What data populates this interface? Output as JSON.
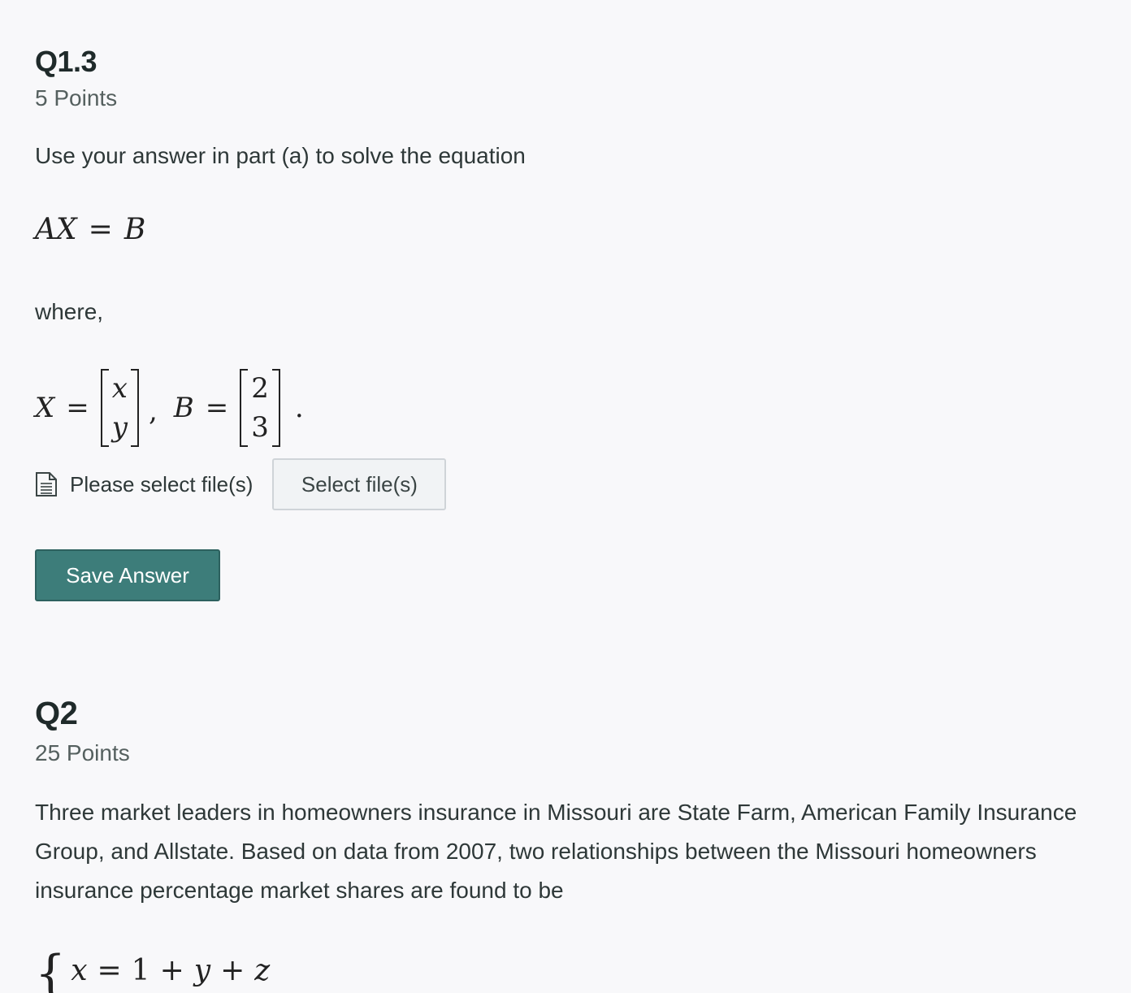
{
  "q1_3": {
    "title": "Q1.3",
    "points": "5 Points",
    "prompt": "Use your answer in part (a) to solve the equation",
    "equation": {
      "lhs_a": "A",
      "lhs_x": "X",
      "eq": "=",
      "rhs": "B"
    },
    "where_label": "where,",
    "definitions": {
      "x_symbol": "X",
      "eq": "=",
      "x_entries": [
        "x",
        "y"
      ],
      "comma": ",",
      "b_symbol": "B",
      "b_entries": [
        "2",
        "3"
      ],
      "period": "."
    },
    "upload": {
      "status": "Please select file(s)",
      "button_label": "Select file(s)",
      "icon": "file-icon"
    },
    "save_label": "Save Answer"
  },
  "q2": {
    "title": "Q2",
    "points": "25 Points",
    "prompt": "Three market leaders in homeowners insurance in Missouri are State Farm, American Family Insurance Group, and Allstate. Based on data from 2007, two relationships between the Missouri homeowners insurance percentage market shares are found to be",
    "system_line1": {
      "brace": "{",
      "x": "x",
      "eq": "=",
      "one": "1",
      "plus1": "+",
      "y": "y",
      "plus2": "+",
      "z": "z"
    }
  },
  "colors": {
    "background": "#f8f8fa",
    "save_button": "#3d7d7a",
    "select_button": "#f1f3f5"
  }
}
